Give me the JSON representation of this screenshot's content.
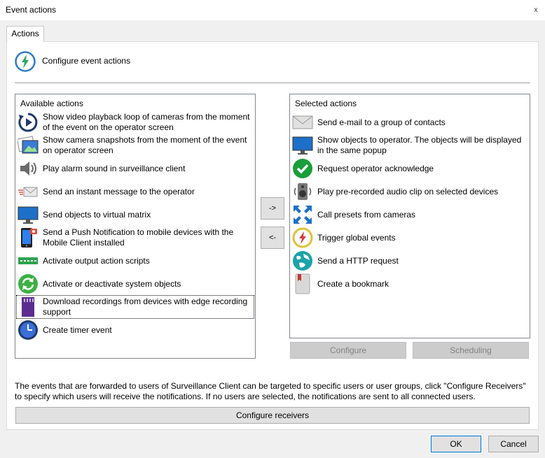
{
  "window": {
    "title": "Event actions",
    "close_glyph": "x"
  },
  "tabs": [
    {
      "label": "Actions",
      "selected": true
    }
  ],
  "header": {
    "label": "Configure event actions",
    "icon": "lightning-circle-icon"
  },
  "available": {
    "title": "Available actions",
    "items": [
      {
        "label": "Show video playback loop of cameras from the moment of the event on the operator screen",
        "icon": "playback-loop-icon"
      },
      {
        "label": "Show camera snapshots from the moment of the event on operator screen",
        "icon": "snapshot-icon"
      },
      {
        "label": "Play alarm sound in surveillance client",
        "icon": "speaker-icon"
      },
      {
        "label": "Send an instant message to the operator",
        "icon": "instant-message-icon"
      },
      {
        "label": "Send objects to virtual matrix",
        "icon": "monitor-icon"
      },
      {
        "label": "Send a Push Notification to mobile devices with the Mobile Client installed",
        "icon": "mobile-phone-icon"
      },
      {
        "label": "Activate output action scripts",
        "icon": "output-script-icon"
      },
      {
        "label": "Activate or deactivate system objects",
        "icon": "refresh-icon"
      },
      {
        "label": "Download recordings from devices with edge recording support",
        "icon": "sd-card-icon",
        "selected": true
      },
      {
        "label": "Create timer event",
        "icon": "clock-icon"
      }
    ]
  },
  "selected": {
    "title": "Selected actions",
    "items": [
      {
        "label": "Send e-mail to a group of contacts",
        "icon": "envelope-icon"
      },
      {
        "label": "Show objects to operator. The objects will be displayed in the same popup",
        "icon": "monitor-icon"
      },
      {
        "label": "Request operator acknowledge",
        "icon": "checkmark-icon"
      },
      {
        "label": "Play pre-recorded audio clip on selected devices",
        "icon": "audio-speaker-icon"
      },
      {
        "label": "Call presets from cameras",
        "icon": "expand-arrows-icon"
      },
      {
        "label": "Trigger global events",
        "icon": "global-event-icon"
      },
      {
        "label": "Send a HTTP request",
        "icon": "globe-icon"
      },
      {
        "label": "Create a bookmark",
        "icon": "bookmark-icon"
      }
    ]
  },
  "move_buttons": {
    "add": "->",
    "remove": "<-"
  },
  "action_buttons": {
    "configure": "Configure",
    "scheduling": "Scheduling"
  },
  "note": "The events that are forwarded to users of Surveillance Client can be targeted to specific users or user groups, click \"Configure Receivers\" to specify which users will receive the notifications. If no users are selected, the notifications are sent to all connected users.",
  "configure_receivers": "Configure receivers",
  "footer": {
    "ok": "OK",
    "cancel": "Cancel"
  }
}
